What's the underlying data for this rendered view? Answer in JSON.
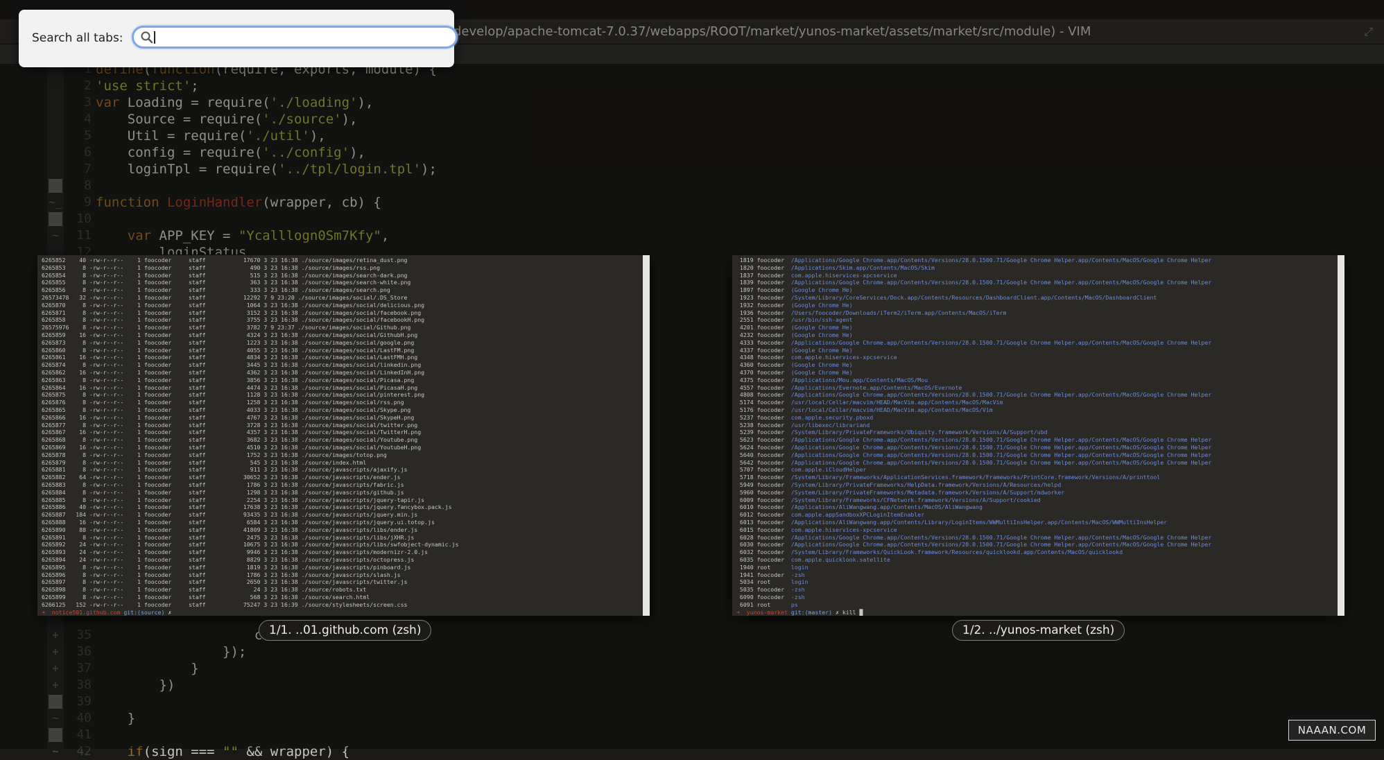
{
  "window": {
    "title": "develop/apache-tomcat-7.0.37/webapps/ROOT/market/yunos-market/assets/market/src/module) - VIM"
  },
  "search": {
    "label": "Search all tabs:",
    "value": "",
    "placeholder": ""
  },
  "editor": {
    "lines": [
      {
        "n": "1",
        "html": "<span class=\"kw\">define</span>(<span class=\"kw\">function</span>(require, exports, module) {"
      },
      {
        "n": "2",
        "html": "<span class=\"str\">'use strict'</span>;"
      },
      {
        "n": "3",
        "html": "<span class=\"kw\">var</span> Loading = require(<span class=\"str\">'./loading'</span>),"
      },
      {
        "n": "4",
        "html": "    Source = require(<span class=\"str\">'./source'</span>),"
      },
      {
        "n": "5",
        "html": "    Util = require(<span class=\"str\">'./util'</span>),"
      },
      {
        "n": "6",
        "html": "    config = require(<span class=\"str\">'../config'</span>),"
      },
      {
        "n": "7",
        "html": "    loginTpl = require(<span class=\"str\">'../tpl/login.tpl'</span>);"
      },
      {
        "n": "8",
        "html": ""
      },
      {
        "n": "9",
        "html": "<span class=\"kw\">function</span> <span class=\"fn\">LoginHandler</span>(wrapper, cb) {"
      },
      {
        "n": "10",
        "html": ""
      },
      {
        "n": "11",
        "html": "    <span class=\"kw\">var</span> APP_KEY = <span class=\"str\">\"Ycalllogn0Sm7Kfy\"</span>,"
      },
      {
        "n": "12",
        "html": "        loginStatus"
      },
      {
        "n": "35",
        "html": "                    ca"
      },
      {
        "n": "36",
        "html": "                });"
      },
      {
        "n": "37",
        "html": "            }"
      },
      {
        "n": "38",
        "html": "        })"
      },
      {
        "n": "39",
        "html": ""
      },
      {
        "n": "40",
        "html": "    }"
      },
      {
        "n": "41",
        "html": ""
      },
      {
        "n": "42",
        "html": "    <span class=\"kw\">if</span>(sign === <span class=\"str\">\"\"</span> && wrapper) {"
      }
    ]
  },
  "tabs": [
    {
      "caption": "1/1. ..01.github.com (zsh)"
    },
    {
      "caption": "1/2. ../yunos-market (zsh)"
    }
  ],
  "left_terminal": {
    "prompt_host": "notice501.github.com",
    "prompt_git": "git:(source)",
    "prompt_tail": "✗",
    "rows": [
      [
        "6265852",
        "40",
        "-rw-r--r--",
        "1",
        "foocoder",
        "staff",
        "17670",
        "3",
        "23",
        "16:38",
        "./source/images/retina_dust.png"
      ],
      [
        "6265853",
        "8",
        "-rw-r--r--",
        "1",
        "foocoder",
        "staff",
        "490",
        "3",
        "23",
        "16:38",
        "./source/images/rss.png"
      ],
      [
        "6265854",
        "8",
        "-rw-r--r--",
        "1",
        "foocoder",
        "staff",
        "515",
        "3",
        "23",
        "16:38",
        "./source/images/search-dark.png"
      ],
      [
        "6265855",
        "8",
        "-rw-r--r--",
        "1",
        "foocoder",
        "staff",
        "363",
        "3",
        "23",
        "16:38",
        "./source/images/search-white.png"
      ],
      [
        "6265856",
        "8",
        "-rw-r--r--",
        "1",
        "foocoder",
        "staff",
        "333",
        "3",
        "23",
        "16:38",
        "./source/images/search.png"
      ],
      [
        "26573478",
        "32",
        "-rw-r--r--",
        "1",
        "foocoder",
        "staff",
        "12292",
        "7",
        "9",
        "23:20",
        "./source/images/social/.DS_Store"
      ],
      [
        "6265870",
        "8",
        "-rw-r--r--",
        "1",
        "foocoder",
        "staff",
        "1064",
        "3",
        "23",
        "16:38",
        "./source/images/social/delicious.png"
      ],
      [
        "6265871",
        "8",
        "-rw-r--r--",
        "1",
        "foocoder",
        "staff",
        "3152",
        "3",
        "23",
        "16:38",
        "./source/images/social/facebook.png"
      ],
      [
        "6265858",
        "8",
        "-rw-r--r--",
        "1",
        "foocoder",
        "staff",
        "3755",
        "3",
        "23",
        "16:38",
        "./source/images/social/facebookH.png"
      ],
      [
        "26575976",
        "8",
        "-rw-r--r--",
        "1",
        "foocoder",
        "staff",
        "3782",
        "7",
        "9",
        "23:37",
        "./source/images/social/Github.png"
      ],
      [
        "6265859",
        "16",
        "-rw-r--r--",
        "1",
        "foocoder",
        "staff",
        "4324",
        "3",
        "23",
        "16:38",
        "./source/images/social/GithubH.png"
      ],
      [
        "6265873",
        "8",
        "-rw-r--r--",
        "1",
        "foocoder",
        "staff",
        "1223",
        "3",
        "23",
        "16:38",
        "./source/images/social/google.png"
      ],
      [
        "6265860",
        "8",
        "-rw-r--r--",
        "1",
        "foocoder",
        "staff",
        "4055",
        "3",
        "23",
        "16:38",
        "./source/images/social/LastFM.png"
      ],
      [
        "6265861",
        "16",
        "-rw-r--r--",
        "1",
        "foocoder",
        "staff",
        "4834",
        "3",
        "23",
        "16:38",
        "./source/images/social/LastFMH.png"
      ],
      [
        "6265874",
        "8",
        "-rw-r--r--",
        "1",
        "foocoder",
        "staff",
        "3445",
        "3",
        "23",
        "16:38",
        "./source/images/social/linkedin.png"
      ],
      [
        "6265862",
        "16",
        "-rw-r--r--",
        "1",
        "foocoder",
        "staff",
        "4362",
        "3",
        "23",
        "16:38",
        "./source/images/social/LinkedInH.png"
      ],
      [
        "6265863",
        "8",
        "-rw-r--r--",
        "1",
        "foocoder",
        "staff",
        "3856",
        "3",
        "23",
        "16:38",
        "./source/images/social/Picasa.png"
      ],
      [
        "6265864",
        "16",
        "-rw-r--r--",
        "1",
        "foocoder",
        "staff",
        "4474",
        "3",
        "23",
        "16:38",
        "./source/images/social/PicasaH.png"
      ],
      [
        "6265875",
        "8",
        "-rw-r--r--",
        "1",
        "foocoder",
        "staff",
        "1128",
        "3",
        "23",
        "16:38",
        "./source/images/social/pinterest.png"
      ],
      [
        "6265876",
        "8",
        "-rw-r--r--",
        "1",
        "foocoder",
        "staff",
        "1258",
        "3",
        "23",
        "16:38",
        "./source/images/social/rss.png"
      ],
      [
        "6265865",
        "8",
        "-rw-r--r--",
        "1",
        "foocoder",
        "staff",
        "4033",
        "3",
        "23",
        "16:38",
        "./source/images/social/Skype.png"
      ],
      [
        "6265866",
        "16",
        "-rw-r--r--",
        "1",
        "foocoder",
        "staff",
        "4767",
        "3",
        "23",
        "16:38",
        "./source/images/social/SkypeH.png"
      ],
      [
        "6265877",
        "8",
        "-rw-r--r--",
        "1",
        "foocoder",
        "staff",
        "3728",
        "3",
        "23",
        "16:38",
        "./source/images/social/twitter.png"
      ],
      [
        "6265867",
        "16",
        "-rw-r--r--",
        "1",
        "foocoder",
        "staff",
        "4357",
        "3",
        "23",
        "16:38",
        "./source/images/social/TwitterH.png"
      ],
      [
        "6265868",
        "8",
        "-rw-r--r--",
        "1",
        "foocoder",
        "staff",
        "3682",
        "3",
        "23",
        "16:38",
        "./source/images/social/Youtube.png"
      ],
      [
        "6265869",
        "16",
        "-rw-r--r--",
        "1",
        "foocoder",
        "staff",
        "4510",
        "3",
        "23",
        "16:38",
        "./source/images/social/YoutubeH.png"
      ],
      [
        "6265878",
        "8",
        "-rw-r--r--",
        "1",
        "foocoder",
        "staff",
        "1752",
        "3",
        "23",
        "16:38",
        "./source/images/totop.png"
      ],
      [
        "6265879",
        "8",
        "-rw-r--r--",
        "1",
        "foocoder",
        "staff",
        "545",
        "3",
        "23",
        "16:38",
        "./source/index.html"
      ],
      [
        "6265881",
        "8",
        "-rw-r--r--",
        "1",
        "foocoder",
        "staff",
        "911",
        "3",
        "23",
        "16:38",
        "./source/javascripts/ajaxify.js"
      ],
      [
        "6265882",
        "64",
        "-rw-r--r--",
        "1",
        "foocoder",
        "staff",
        "30652",
        "3",
        "23",
        "16:38",
        "./source/javascripts/ender.js"
      ],
      [
        "6265883",
        "8",
        "-rw-r--r--",
        "1",
        "foocoder",
        "staff",
        "1786",
        "3",
        "23",
        "16:38",
        "./source/javascripts/fabric.js"
      ],
      [
        "6265884",
        "8",
        "-rw-r--r--",
        "1",
        "foocoder",
        "staff",
        "1298",
        "3",
        "23",
        "16:38",
        "./source/javascripts/github.js"
      ],
      [
        "6265885",
        "8",
        "-rw-r--r--",
        "1",
        "foocoder",
        "staff",
        "2254",
        "3",
        "23",
        "16:38",
        "./source/javascripts/jquery-tapir.js"
      ],
      [
        "6265886",
        "40",
        "-rw-r--r--",
        "1",
        "foocoder",
        "staff",
        "17638",
        "3",
        "23",
        "16:38",
        "./source/javascripts/jquery.fancybox.pack.js"
      ],
      [
        "6265887",
        "184",
        "-rw-r--r--",
        "1",
        "foocoder",
        "staff",
        "93435",
        "3",
        "23",
        "16:38",
        "./source/javascripts/jquery.min.js"
      ],
      [
        "6265888",
        "16",
        "-rw-r--r--",
        "1",
        "foocoder",
        "staff",
        "6584",
        "3",
        "23",
        "16:38",
        "./source/javascripts/jquery.ui.totop.js"
      ],
      [
        "6265890",
        "88",
        "-rw-r--r--",
        "1",
        "foocoder",
        "staff",
        "41809",
        "3",
        "23",
        "16:38",
        "./source/javascripts/libs/ender.js"
      ],
      [
        "6265891",
        "8",
        "-rw-r--r--",
        "1",
        "foocoder",
        "staff",
        "2475",
        "3",
        "23",
        "16:38",
        "./source/javascripts/libs/jXHR.js"
      ],
      [
        "6265892",
        "24",
        "-rw-r--r--",
        "1",
        "foocoder",
        "staff",
        "10675",
        "3",
        "23",
        "16:38",
        "./source/javascripts/libs/swfobject-dynamic.js"
      ],
      [
        "6265893",
        "24",
        "-rw-r--r--",
        "1",
        "foocoder",
        "staff",
        "9946",
        "3",
        "23",
        "16:38",
        "./source/javascripts/modernizr-2.0.js"
      ],
      [
        "6265894",
        "24",
        "-rw-r--r--",
        "1",
        "foocoder",
        "staff",
        "8829",
        "3",
        "23",
        "16:38",
        "./source/javascripts/octopress.js"
      ],
      [
        "6265895",
        "8",
        "-rw-r--r--",
        "1",
        "foocoder",
        "staff",
        "1819",
        "3",
        "23",
        "16:38",
        "./source/javascripts/pinboard.js"
      ],
      [
        "6265896",
        "8",
        "-rw-r--r--",
        "1",
        "foocoder",
        "staff",
        "1786",
        "3",
        "23",
        "16:38",
        "./source/javascripts/slash.js"
      ],
      [
        "6265897",
        "8",
        "-rw-r--r--",
        "1",
        "foocoder",
        "staff",
        "2650",
        "3",
        "23",
        "16:38",
        "./source/javascripts/twitter.js"
      ],
      [
        "6265898",
        "8",
        "-rw-r--r--",
        "1",
        "foocoder",
        "staff",
        "24",
        "3",
        "23",
        "16:38",
        "./source/robots.txt"
      ],
      [
        "6265899",
        "8",
        "-rw-r--r--",
        "1",
        "foocoder",
        "staff",
        "568",
        "3",
        "23",
        "16:38",
        "./source/search.html"
      ],
      [
        "6266125",
        "152",
        "-rw-r--r--",
        "1",
        "foocoder",
        "staff",
        "75247",
        "3",
        "23",
        "16:39",
        "./source/stylesheets/screen.css"
      ]
    ]
  },
  "right_terminal": {
    "prompt_host": "yunos-market",
    "prompt_git": "git:(master)",
    "prompt_tail": "✗ kill",
    "rows": [
      [
        "1819",
        "foocoder",
        "/Applications/Google Chrome.app/Contents/Versions/28.0.1500.71/Google Chrome Helper.app/Contents/MacOS/Google Chrome Helper"
      ],
      [
        "1820",
        "foocoder",
        "/Applications/Skim.app/Contents/MacOS/Skim"
      ],
      [
        "1837",
        "foocoder",
        "com.apple.hiservices-xpcservice"
      ],
      [
        "1839",
        "foocoder",
        "/Applications/Google Chrome.app/Contents/Versions/28.0.1500.71/Google Chrome Helper.app/Contents/MacOS/Google Chrome Helper"
      ],
      [
        "1897",
        "foocoder",
        "(Google Chrome He)"
      ],
      [
        "1923",
        "foocoder",
        "/System/Library/CoreServices/Dock.app/Contents/Resources/DashboardClient.app/Contents/MacOS/DashboardClient"
      ],
      [
        "1932",
        "foocoder",
        "(Google Chrome He)"
      ],
      [
        "1936",
        "foocoder",
        "/Users/foocoder/Downloads/iTerm2/iTerm.app/Contents/MacOS/iTerm"
      ],
      [
        "2551",
        "foocoder",
        "/usr/bin/ssh-agent"
      ],
      [
        "4201",
        "foocoder",
        "(Google Chrome He)"
      ],
      [
        "4232",
        "foocoder",
        "(Google Chrome He)"
      ],
      [
        "4333",
        "foocoder",
        "/Applications/Google Chrome.app/Contents/Versions/28.0.1500.71/Google Chrome Helper.app/Contents/MacOS/Google Chrome Helper"
      ],
      [
        "4337",
        "foocoder",
        "(Google Chrome He)"
      ],
      [
        "4348",
        "foocoder",
        "com.apple.hiservices-xpcservice"
      ],
      [
        "4360",
        "foocoder",
        "(Google Chrome He)"
      ],
      [
        "4370",
        "foocoder",
        "(Google Chrome He)"
      ],
      [
        "4375",
        "foocoder",
        "/Applications/Mou.app/Contents/MacOS/Mou"
      ],
      [
        "4557",
        "foocoder",
        "/Applications/Evernote.app/Contents/MacOS/Evernote"
      ],
      [
        "4808",
        "foocoder",
        "/Applications/Google Chrome.app/Contents/Versions/28.0.1500.71/Google Chrome Helper.app/Contents/MacOS/Google Chrome Helper"
      ],
      [
        "5174",
        "foocoder",
        "/usr/local/Cellar/macvim/HEAD/MacVim.app/Contents/MacOS/MacVim"
      ],
      [
        "5176",
        "foocoder",
        "/usr/local/Cellar/macvim/HEAD/MacVim.app/Contents/MacOS/Vim"
      ],
      [
        "5237",
        "foocoder",
        "com.apple.security.pboxd"
      ],
      [
        "5238",
        "foocoder",
        "/usr/libexec/librariand"
      ],
      [
        "5239",
        "foocoder",
        "/System/Library/PrivateFrameworks/Ubiquity.framework/Versions/A/Support/ubd"
      ],
      [
        "5623",
        "foocoder",
        "/Applications/Google Chrome.app/Contents/Versions/28.0.1500.71/Google Chrome Helper.app/Contents/MacOS/Google Chrome Helper"
      ],
      [
        "5624",
        "foocoder",
        "/Applications/Google Chrome.app/Contents/Versions/28.0.1500.71/Google Chrome Helper.app/Contents/MacOS/Google Chrome Helper"
      ],
      [
        "5640",
        "foocoder",
        "/Applications/Google Chrome.app/Contents/Versions/28.0.1500.71/Google Chrome Helper.app/Contents/MacOS/Google Chrome Helper"
      ],
      [
        "5642",
        "foocoder",
        "/Applications/Google Chrome.app/Contents/Versions/28.0.1500.71/Google Chrome Helper.app/Contents/MacOS/Google Chrome Helper"
      ],
      [
        "5707",
        "foocoder",
        "com.apple.iCloudHelper"
      ],
      [
        "5718",
        "foocoder",
        "/System/Library/Frameworks/ApplicationServices.framework/Frameworks/PrintCore.framework/Versions/A/printtool"
      ],
      [
        "5949",
        "foocoder",
        "/System/Library/PrivateFrameworks/HelpData.framework/Versions/A/Resources/helpd"
      ],
      [
        "5960",
        "foocoder",
        "/System/Library/PrivateFrameworks/Metadata.framework/Versions/A/Support/mdworker"
      ],
      [
        "6009",
        "foocoder",
        "/System/Library/Frameworks/CFNetwork.framework/Versions/A/Support/cookied"
      ],
      [
        "6010",
        "foocoder",
        "/Applications/AliWangwang.app/Contents/MacOS/AliWangwang"
      ],
      [
        "6012",
        "foocoder",
        "com.apple.appSandboxXPCLoginItemEnabler"
      ],
      [
        "6013",
        "foocoder",
        "/Applications/AliWangwang.app/Contents/Library/LoginItems/WWMultiInsHelper.app/Contents/MacOS/WWMultiInsHelper"
      ],
      [
        "6015",
        "foocoder",
        "com.apple.hiservices-xpcservice"
      ],
      [
        "6028",
        "foocoder",
        "/Applications/Google Chrome.app/Contents/Versions/28.0.1500.71/Google Chrome Helper.app/Contents/MacOS/Google Chrome Helper"
      ],
      [
        "6030",
        "foocoder",
        "/Applications/Google Chrome.app/Contents/Versions/28.0.1500.71/Google Chrome Helper.app/Contents/MacOS/Google Chrome Helper"
      ],
      [
        "6032",
        "foocoder",
        "/System/Library/Frameworks/QuickLook.framework/Resources/quicklookd.app/Contents/MacOS/quicklookd"
      ],
      [
        "6035",
        "foocoder",
        "com.apple.quicklook.satellite"
      ],
      [
        "1940",
        "root",
        "login"
      ],
      [
        "1941",
        "foocoder",
        "-zsh"
      ],
      [
        "5034",
        "root",
        "login"
      ],
      [
        "5035",
        "foocoder",
        "-zsh"
      ],
      [
        "6090",
        "foocoder",
        "-zsh"
      ],
      [
        "6091",
        "root",
        "ps"
      ]
    ]
  },
  "watermark": "NAAAN.COM",
  "colors": {
    "background": "#1b1a18",
    "terminal_bg": "#2a2926",
    "path_blue": "#6e8ce0",
    "prompt_red": "#d24430",
    "search_ring": "#7ea7e8"
  }
}
